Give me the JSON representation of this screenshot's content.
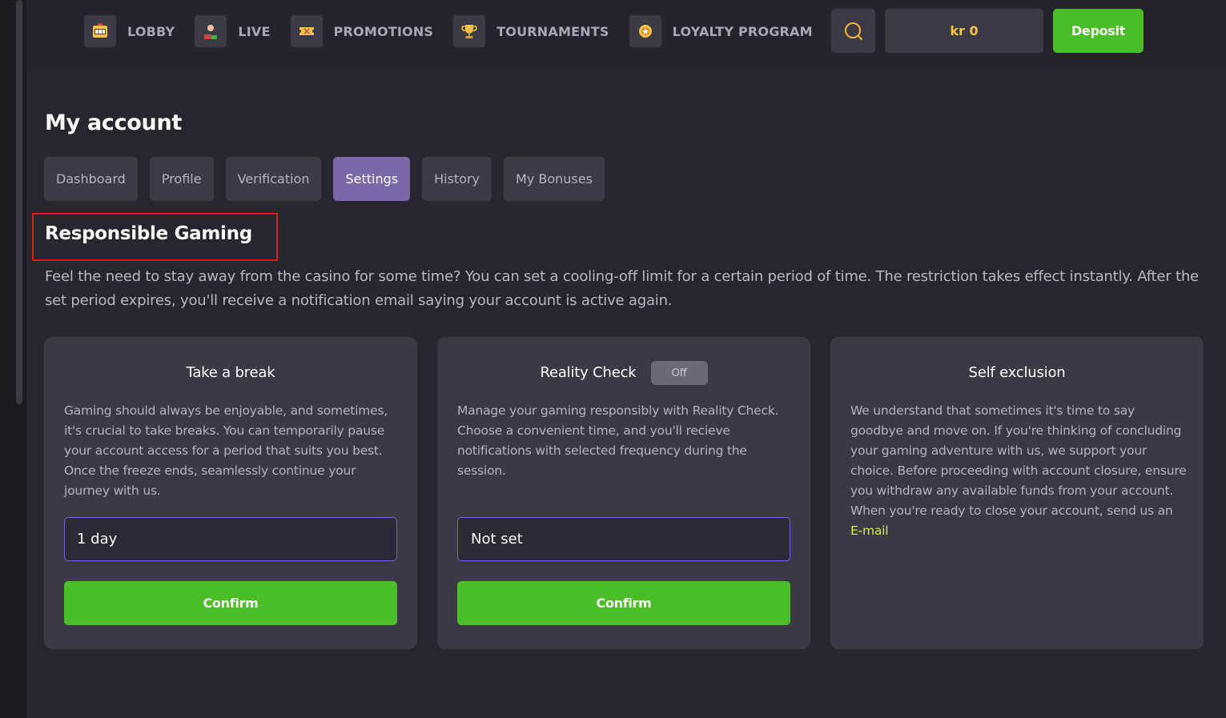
{
  "nav": {
    "items": [
      {
        "label": "LOBBY",
        "icon": "slot-machine-icon"
      },
      {
        "label": "LIVE",
        "icon": "live-dealer-icon"
      },
      {
        "label": "PROMOTIONS",
        "icon": "ticket-icon"
      },
      {
        "label": "TOURNAMENTS",
        "icon": "trophy-icon"
      },
      {
        "label": "LOYALTY PROGRAM",
        "icon": "loyalty-badge-icon"
      }
    ]
  },
  "header": {
    "search_icon": "search-icon",
    "balance": "kr 0",
    "deposit_label": "Deposit"
  },
  "page": {
    "title": "My account",
    "tabs": [
      {
        "label": "Dashboard",
        "active": false
      },
      {
        "label": "Profile",
        "active": false
      },
      {
        "label": "Verification",
        "active": false
      },
      {
        "label": "Settings",
        "active": true
      },
      {
        "label": "History",
        "active": false
      },
      {
        "label": "My Bonuses",
        "active": false
      }
    ]
  },
  "section": {
    "title": "Responsible Gaming",
    "intro": "Feel the need to stay away from the casino for some time? You can set a cooling-off limit for a certain period of time. The restriction takes effect instantly. After the set period expires, you'll receive a notification email saying your account is active again."
  },
  "cards": {
    "break": {
      "title": "Take a break",
      "text": "Gaming should always be enjoyable, and sometimes, it's crucial to take breaks. You can temporarily pause your account access for a period that suits you best. Once the freeze ends, seamlessly continue your journey with us.",
      "select_value": "1 day",
      "confirm_label": "Confirm"
    },
    "reality": {
      "title": "Reality Check",
      "toggle_label": "Off",
      "text": "Manage your gaming responsibly with Reality Check. Choose a convenient time, and you'll recieve notifications with selected frequency during the session.",
      "select_value": "Not set",
      "confirm_label": "Confirm"
    },
    "exclusion": {
      "title": "Self exclusion",
      "text": "We understand that sometimes it's time to say goodbye and move on. If you're thinking of concluding your gaming adventure with us, we support your choice. Before proceeding with account closure, ensure you withdraw any available funds from your account.",
      "text2": "When you're ready to close your account, send us an",
      "link_label": "E-mail"
    }
  },
  "colors": {
    "background": "#27262f",
    "card": "#3a3945",
    "accent_green": "#4bbd27",
    "active_tab": "#7a68a8",
    "balance_yellow": "#f6c443",
    "highlight_red": "#e3151d",
    "link": "#d6ec3d"
  }
}
